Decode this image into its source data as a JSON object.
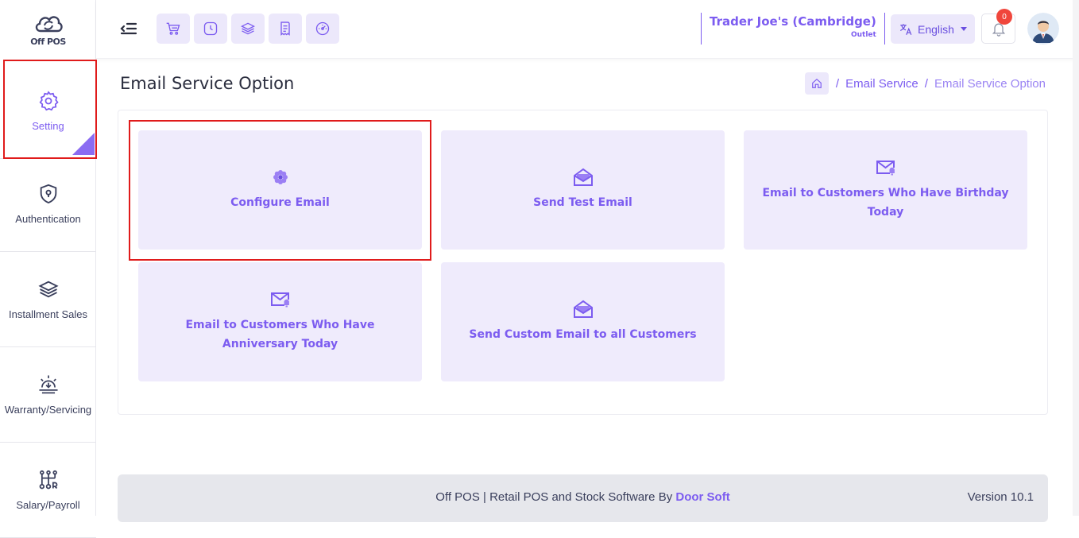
{
  "app": {
    "logo_text": "Off POS"
  },
  "sidebar": {
    "items": [
      {
        "label": "Setting",
        "icon": "gear-icon",
        "active": true
      },
      {
        "label": "Authentication",
        "icon": "shield-icon",
        "active": false
      },
      {
        "label": "Installment Sales",
        "icon": "layers-icon",
        "active": false
      },
      {
        "label": "Warranty/Servicing",
        "icon": "service-icon",
        "active": false
      },
      {
        "label": "Salary/Payroll",
        "icon": "payroll-icon",
        "active": false
      }
    ]
  },
  "topbar": {
    "quick_icons": [
      "cart-icon",
      "clock-icon",
      "layers-icon",
      "receipt-icon",
      "dashboard-icon"
    ],
    "outlet_name": "Trader Joe's (Cambridge)",
    "outlet_label": "Outlet",
    "language": "English",
    "notification_count": "0"
  },
  "page": {
    "title": "Email Service Option",
    "breadcrumb": [
      {
        "label": "Email Service"
      },
      {
        "label": "Email Service Option"
      }
    ],
    "separator": "/"
  },
  "tiles": [
    {
      "label": "Configure Email",
      "icon": "flower-gear-icon"
    },
    {
      "label": "Send Test Email",
      "icon": "open-envelope-icon"
    },
    {
      "label": "Email to Customers Who Have Birthday Today",
      "icon": "mail-alert-icon"
    },
    {
      "label": "Email to Customers Who Have Anniversary Today",
      "icon": "mail-alert-icon"
    },
    {
      "label": "Send Custom Email to all Customers",
      "icon": "open-envelope-icon"
    }
  ],
  "footer": {
    "text": "Off POS | Retail POS and Stock Software By",
    "brand": "Door Soft",
    "version": "Version 10.1"
  },
  "colors": {
    "accent": "#7c5cf0",
    "tile_bg": "#efebfc",
    "highlight": "#e01b1b"
  }
}
